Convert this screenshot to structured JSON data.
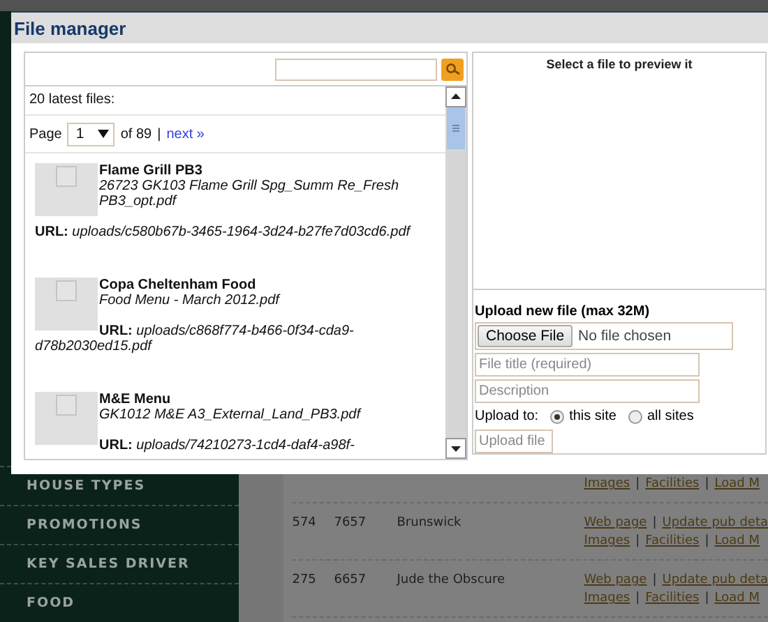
{
  "background": {
    "sidebar": [
      "HOUSE TYPES",
      "PROMOTIONS",
      "KEY SALES DRIVER",
      "FOOD"
    ],
    "separator": "|",
    "rows": [
      {
        "cells": [],
        "link_lines": [
          [
            "Images",
            "Facilities",
            "Load M"
          ]
        ]
      },
      {
        "cells": [
          "574",
          "7657",
          "Brunswick"
        ],
        "link_lines": [
          [
            "Web page",
            "Update pub deta"
          ],
          [
            "Images",
            "Facilities",
            "Load M"
          ]
        ]
      },
      {
        "cells": [
          "275",
          "6657",
          "Jude the Obscure"
        ],
        "link_lines": [
          [
            "Web page",
            "Update pub deta"
          ],
          [
            "Images",
            "Facilities",
            "Load M"
          ]
        ]
      }
    ]
  },
  "dialog": {
    "title": "File manager"
  },
  "file_list": {
    "heading": "20 latest files:",
    "pager": {
      "label": "Page",
      "page": "1",
      "of": "of 89",
      "separator": "|",
      "next": "next »"
    },
    "files": [
      {
        "title": "Flame Grill PB3",
        "filename": "26723 GK103 Flame Grill Spg_Summ Re_Fresh PB3_opt.pdf",
        "url_label": "URL:",
        "url": "uploads/c580b67b-3465-1964-3d24-b27fe7d03cd6.pdf"
      },
      {
        "title": "Copa Cheltenham Food",
        "filename": "Food Menu - March 2012.pdf",
        "url_label": "URL:",
        "url": "uploads/c868f774-b466-0f34-cda9-d78b2030ed15.pdf"
      },
      {
        "title": "M&E Menu",
        "filename": "GK1012 M&E A3_External_Land_PB3.pdf",
        "url_label": "URL:",
        "url": "uploads/74210273-1cd4-daf4-a98f-"
      }
    ]
  },
  "preview": {
    "message": "Select a file to preview it"
  },
  "upload": {
    "heading": "Upload new file (max 32M)",
    "choose_button": "Choose File",
    "file_status": "No file chosen",
    "title_field": {
      "placeholder": "File title (required)"
    },
    "description_field": {
      "placeholder": "Description"
    },
    "target_label": "Upload to:",
    "targets": [
      {
        "label": "this site",
        "selected": true
      },
      {
        "label": "all sites",
        "selected": false
      }
    ],
    "submit": "Upload file"
  }
}
